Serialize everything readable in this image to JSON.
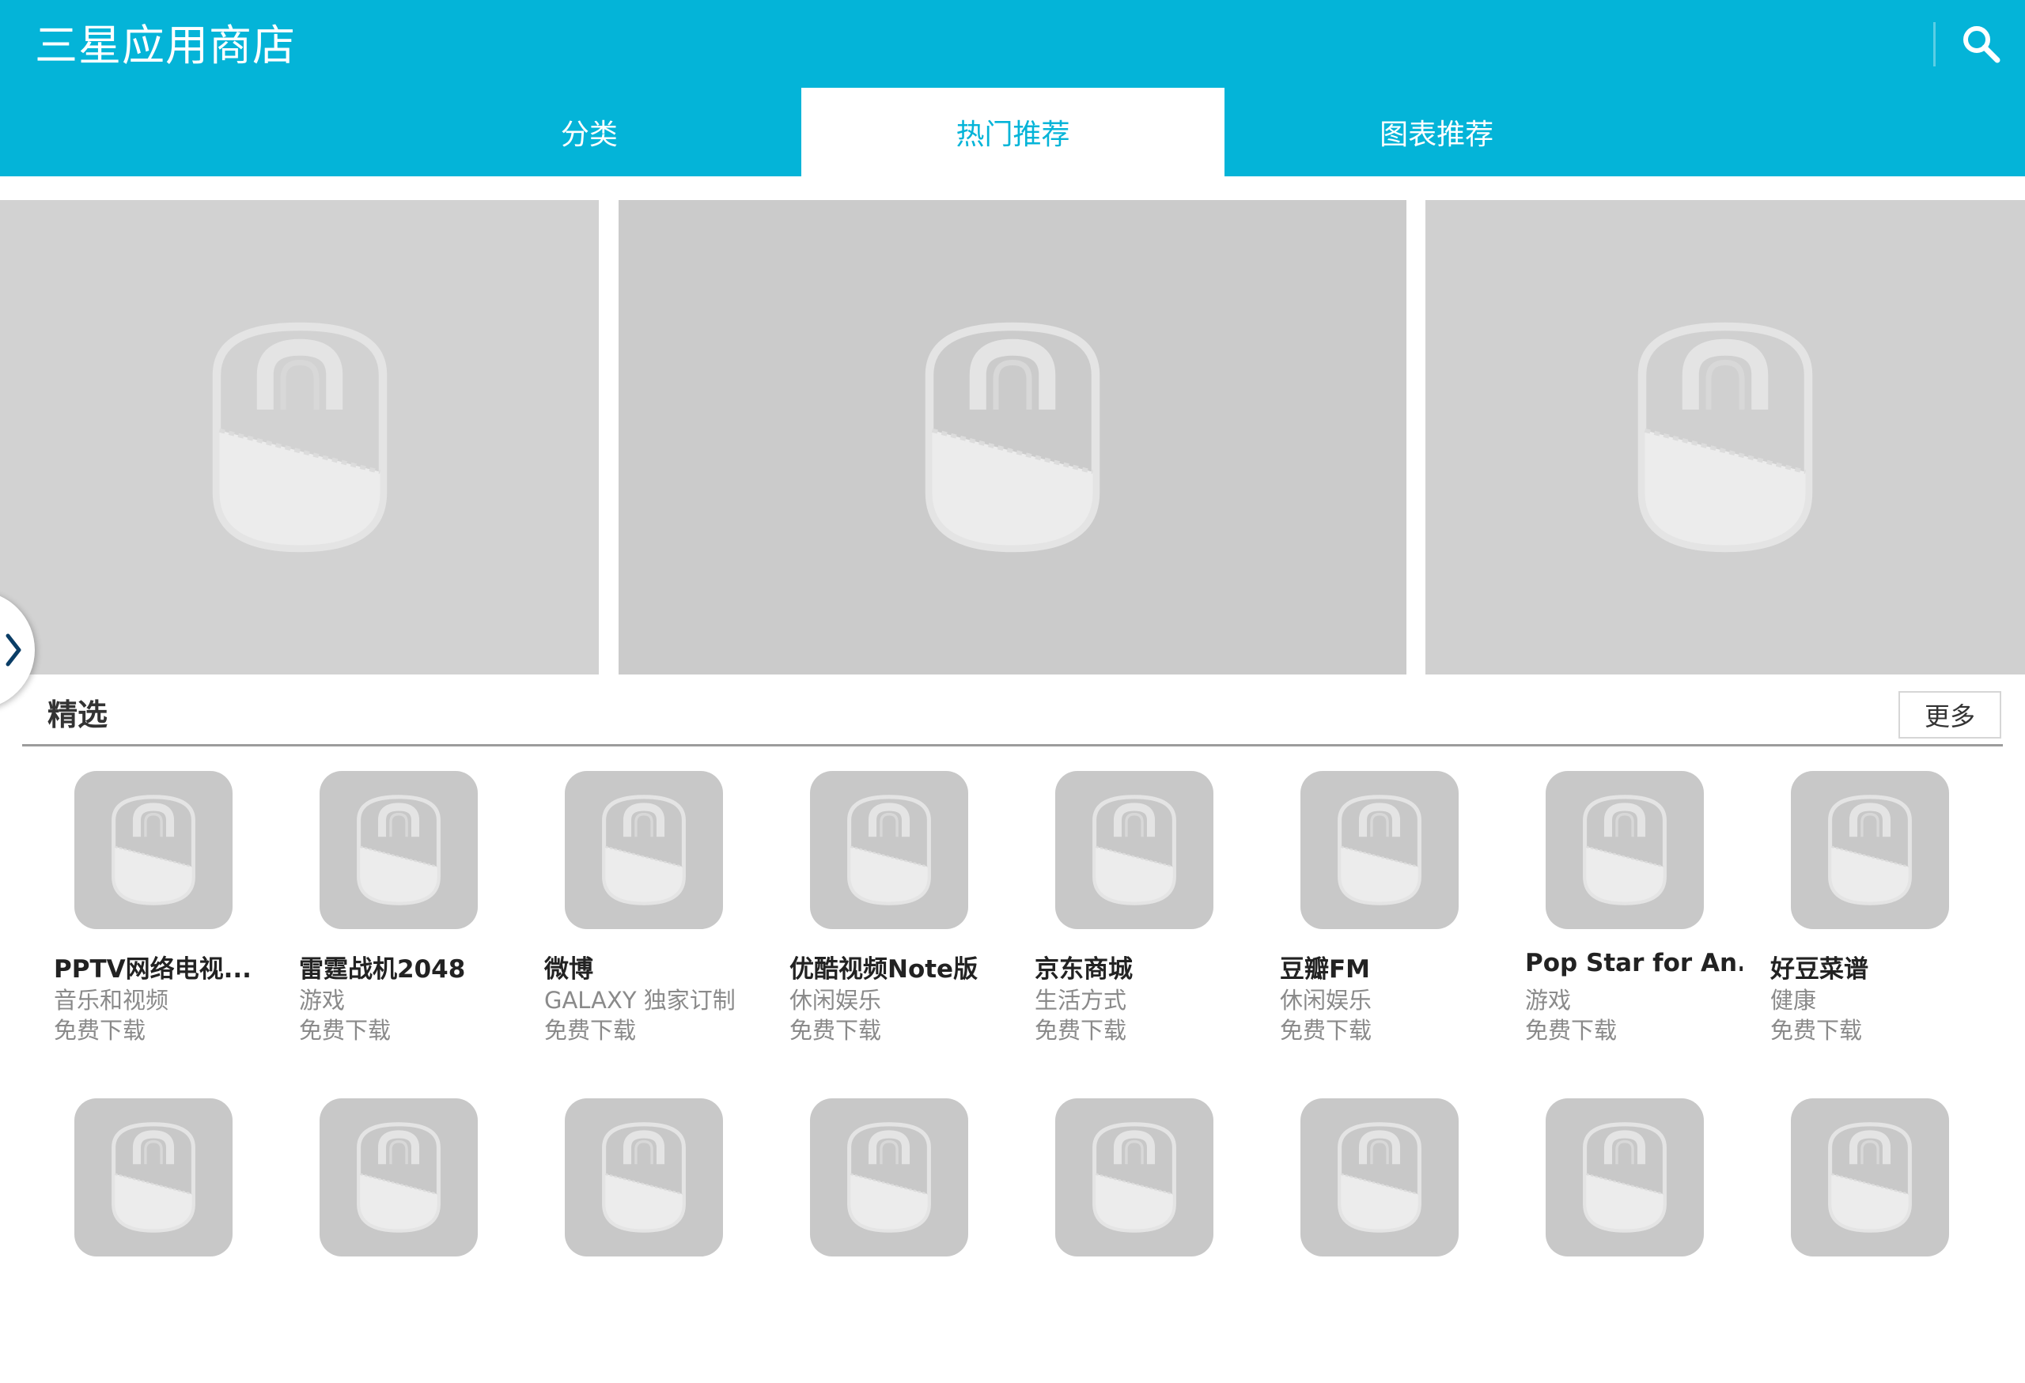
{
  "header": {
    "title": "三星应用商店",
    "search_icon": "search-icon",
    "accent_color": "#04b4d8"
  },
  "tabs": [
    {
      "label": "分类",
      "active": false
    },
    {
      "label": "热门推荐",
      "active": true
    },
    {
      "label": "图表推荐",
      "active": false
    }
  ],
  "banners": [
    {
      "icon": "shopping-bag-placeholder-icon"
    },
    {
      "icon": "shopping-bag-placeholder-icon"
    },
    {
      "icon": "shopping-bag-placeholder-icon"
    }
  ],
  "carousel_arrow_icon": "chevron-right-icon",
  "featured": {
    "title": "精选",
    "more_label": "更多",
    "apps": [
      {
        "name": "PPTV网络电视...",
        "category": "音乐和视频",
        "price": "免费下载"
      },
      {
        "name": "雷霆战机2048",
        "category": "游戏",
        "price": "免费下载"
      },
      {
        "name": "微博",
        "category": "GALAXY 独家订制",
        "price": "免费下载"
      },
      {
        "name": "优酷视频Note版",
        "category": "休闲娱乐",
        "price": "免费下载"
      },
      {
        "name": "京东商城",
        "category": "生活方式",
        "price": "免费下载"
      },
      {
        "name": "豆瓣FM",
        "category": "休闲娱乐",
        "price": "免费下载"
      },
      {
        "name": "Pop Star for An...",
        "category": "游戏",
        "price": "免费下载"
      },
      {
        "name": "好豆菜谱",
        "category": "健康",
        "price": "免费下载"
      }
    ],
    "second_row_icon_count": 8
  }
}
